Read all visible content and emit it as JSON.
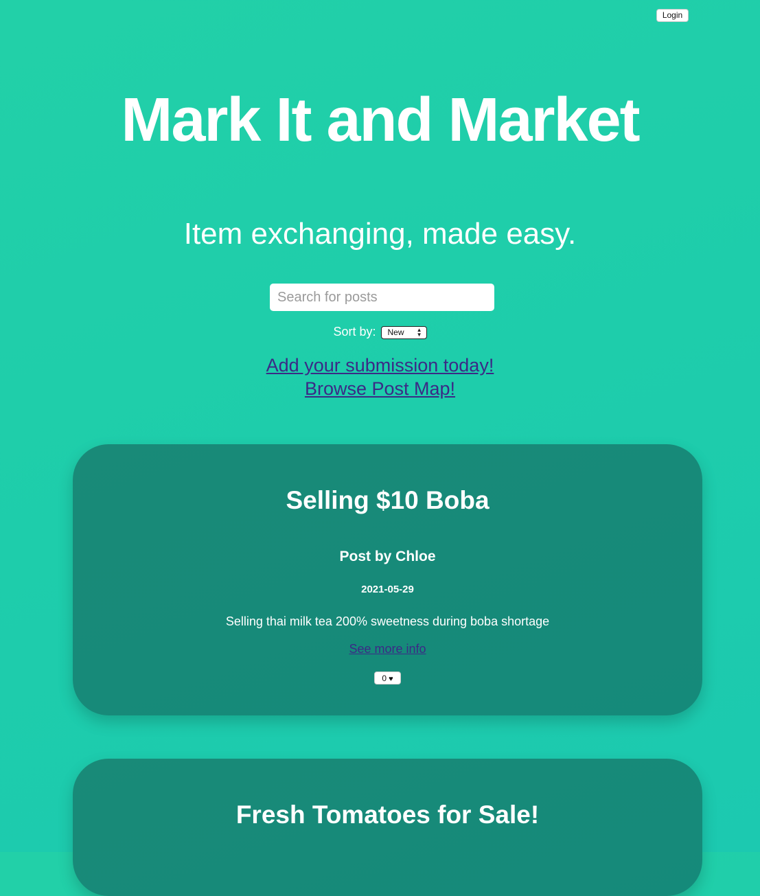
{
  "header": {
    "login_label": "Login"
  },
  "hero": {
    "title": "Mark It and Market",
    "tagline": "Item exchanging, made easy."
  },
  "search": {
    "placeholder": "Search for posts",
    "value": ""
  },
  "sort": {
    "label": "Sort by:",
    "selected": "New"
  },
  "links": {
    "add_submission": "Add your submission today!",
    "browse_map": "Browse Post Map!"
  },
  "posts": [
    {
      "title": "Selling $10 Boba",
      "author": "Post by Chloe",
      "date": "2021-05-29",
      "description": "Selling thai milk tea 200% sweetness during boba shortage",
      "more_link": "See more info",
      "likes": "0",
      "like_icon": "heart-icon"
    },
    {
      "title": "Fresh Tomatoes for Sale!"
    }
  ],
  "colors": {
    "background": "#1ecdab",
    "card": "#178a79",
    "link": "#3b2a86",
    "text": "#ffffff"
  }
}
